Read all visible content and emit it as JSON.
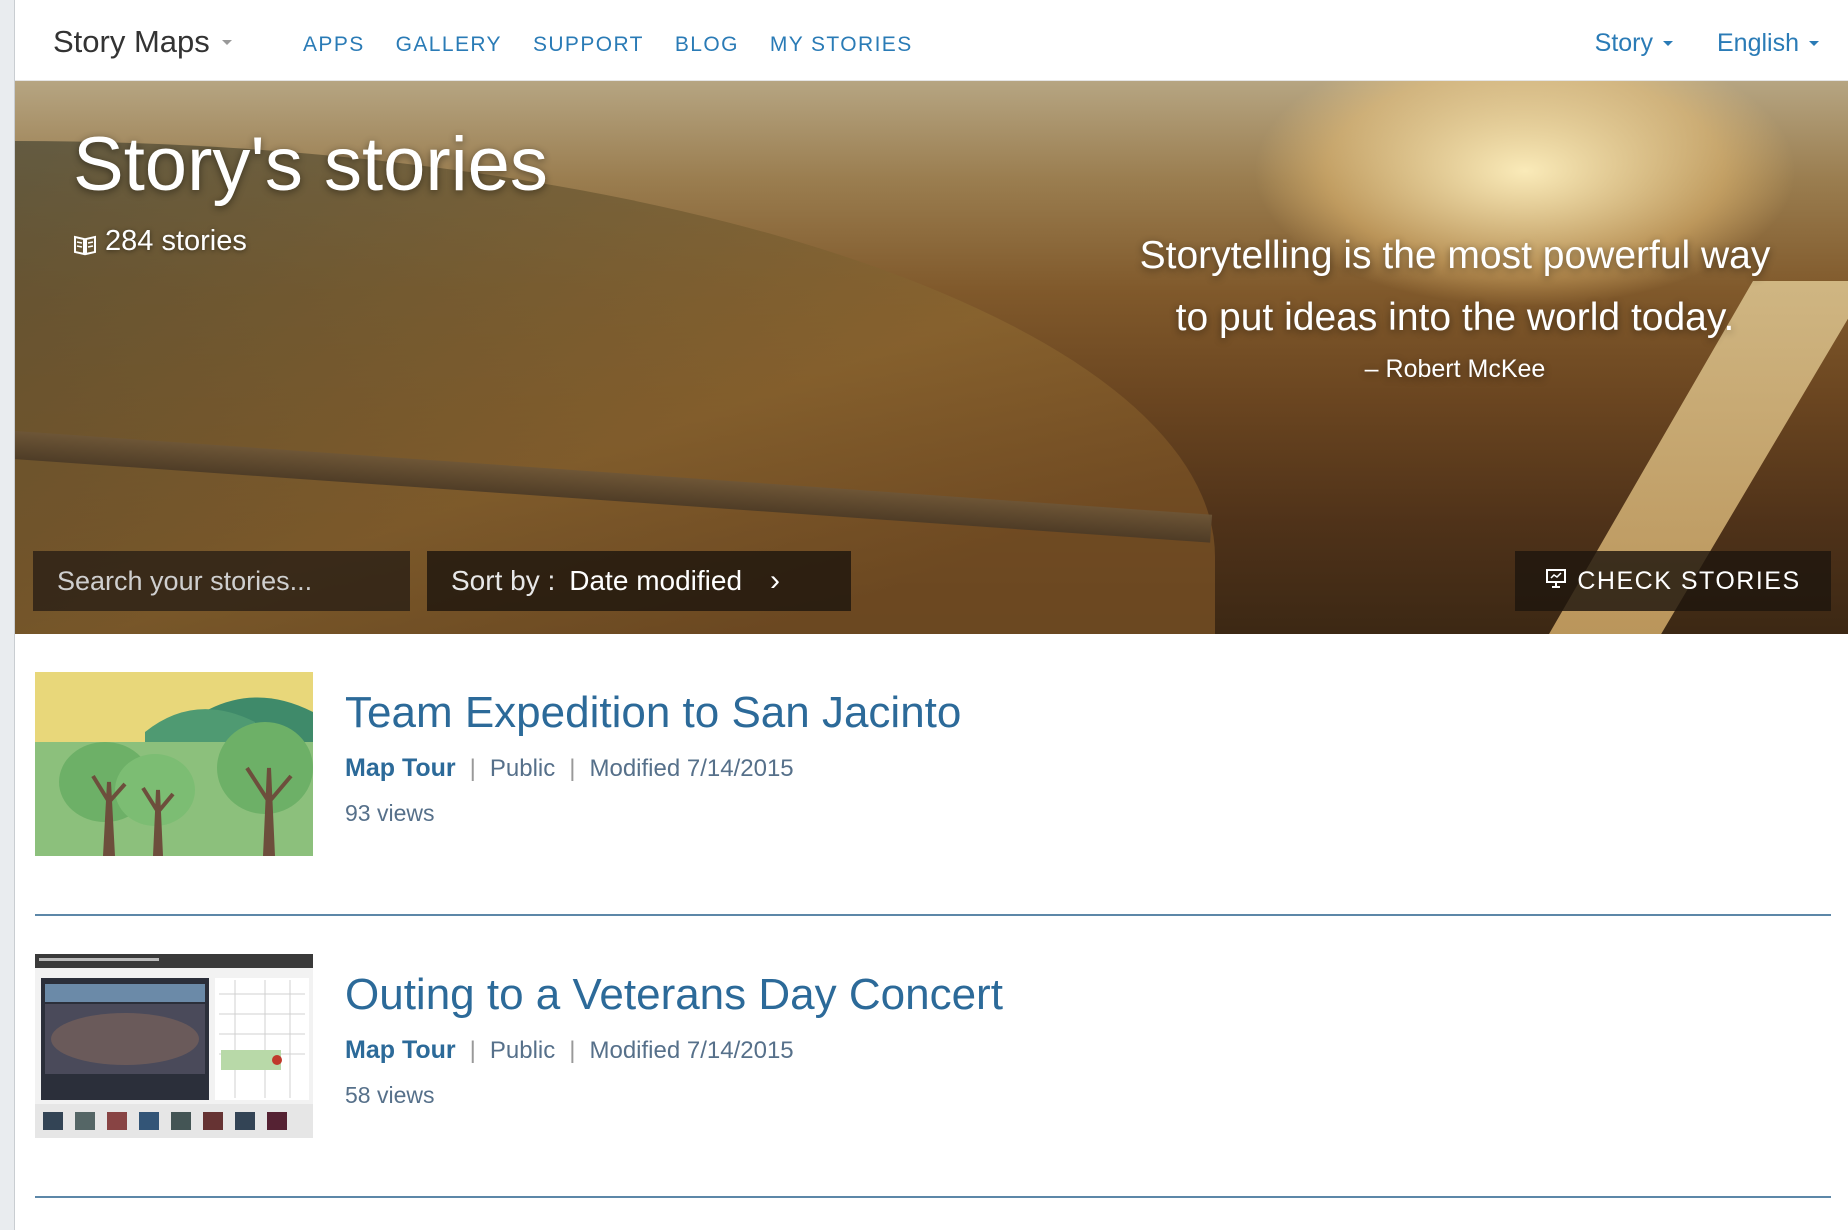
{
  "nav": {
    "brand": "Story Maps",
    "links": [
      "APPS",
      "GALLERY",
      "SUPPORT",
      "BLOG",
      "MY STORIES"
    ],
    "user_label": "Story",
    "language_label": "English"
  },
  "hero": {
    "title": "Story's stories",
    "count": "284 stories",
    "quote_line1": "Storytelling is the most powerful way",
    "quote_line2": "to put ideas into the world today.",
    "quote_author": "– Robert McKee",
    "search_placeholder": "Search your stories...",
    "sort_label": "Sort by :",
    "sort_value": "Date modified",
    "check_button": "CHECK STORIES"
  },
  "stories": [
    {
      "title": "Team Expedition to San Jacinto",
      "type": "Map Tour",
      "visibility": "Public",
      "modified": "Modified 7/14/2015",
      "views": "93 views",
      "thumb_icon": "trees-illustration"
    },
    {
      "title": "Outing to a Veterans Day Concert",
      "type": "Map Tour",
      "visibility": "Public",
      "modified": "Modified 7/14/2015",
      "views": "58 views",
      "thumb_icon": "map-tour-screenshot"
    }
  ],
  "colors": {
    "link": "#2a7bb6",
    "title": "#2c6a99",
    "divider": "#5c87a8"
  }
}
